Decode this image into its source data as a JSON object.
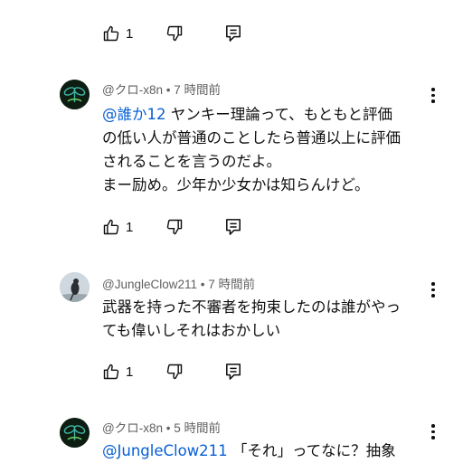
{
  "top_actions": {
    "like_count": "1"
  },
  "comments": [
    {
      "author": "@クロ-x8n",
      "time": "7 時間前",
      "mention": "@誰か12",
      "text_first": "ヤンキー理論って、もともと評価",
      "text_lines": [
        "の低い人が普通のことしたら普通以上に評価",
        "されることを言うのだよ。",
        "まー励め。少年か少女かは知らんけど。"
      ],
      "like_count": "1"
    },
    {
      "author": "@JungleClow211",
      "time": "7 時間前",
      "text_lines": [
        "武器を持った不審者を拘束したのは誰がやっ",
        "ても偉いしそれはおかしい"
      ],
      "like_count": "1"
    },
    {
      "author": "@クロ-x8n",
      "time": "5 時間前",
      "mention": "@JungleClow211",
      "text_first": "「それ」ってなに？抽象"
    }
  ],
  "separator": "•",
  "icons": [
    "thumb-up-icon",
    "thumb-down-icon",
    "reply-icon",
    "more-vert-icon"
  ]
}
